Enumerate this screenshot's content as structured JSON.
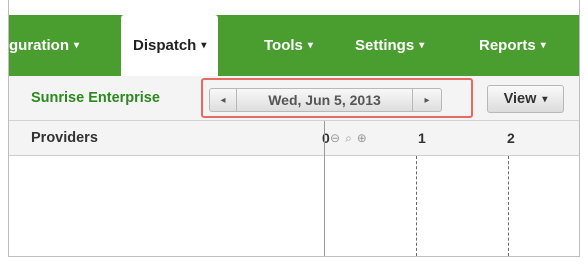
{
  "nav": {
    "items": [
      {
        "label": "guration",
        "caret": "▾"
      },
      {
        "label": "Dispatch",
        "caret": "▾"
      },
      {
        "label": "Tools",
        "caret": "▾"
      },
      {
        "label": "Settings",
        "caret": "▾"
      },
      {
        "label": "Reports",
        "caret": "▾"
      }
    ],
    "active_index": 1
  },
  "toolbar": {
    "company": "Sunrise Enterprise",
    "date": "Wed, Jun 5, 2013",
    "prev_icon": "◂",
    "next_icon": "▸",
    "view_label": "View",
    "view_caret": "▾"
  },
  "grid": {
    "providers_header": "Providers",
    "ticks": [
      "0",
      "1",
      "2"
    ],
    "zoom_icons": [
      "zoom-reset-icon",
      "zoom-in-icon",
      "zoom-out-icon"
    ]
  },
  "colors": {
    "nav_green": "#4a9e2f",
    "company_green": "#2c8a1f",
    "highlight_border": "#e46a62"
  }
}
